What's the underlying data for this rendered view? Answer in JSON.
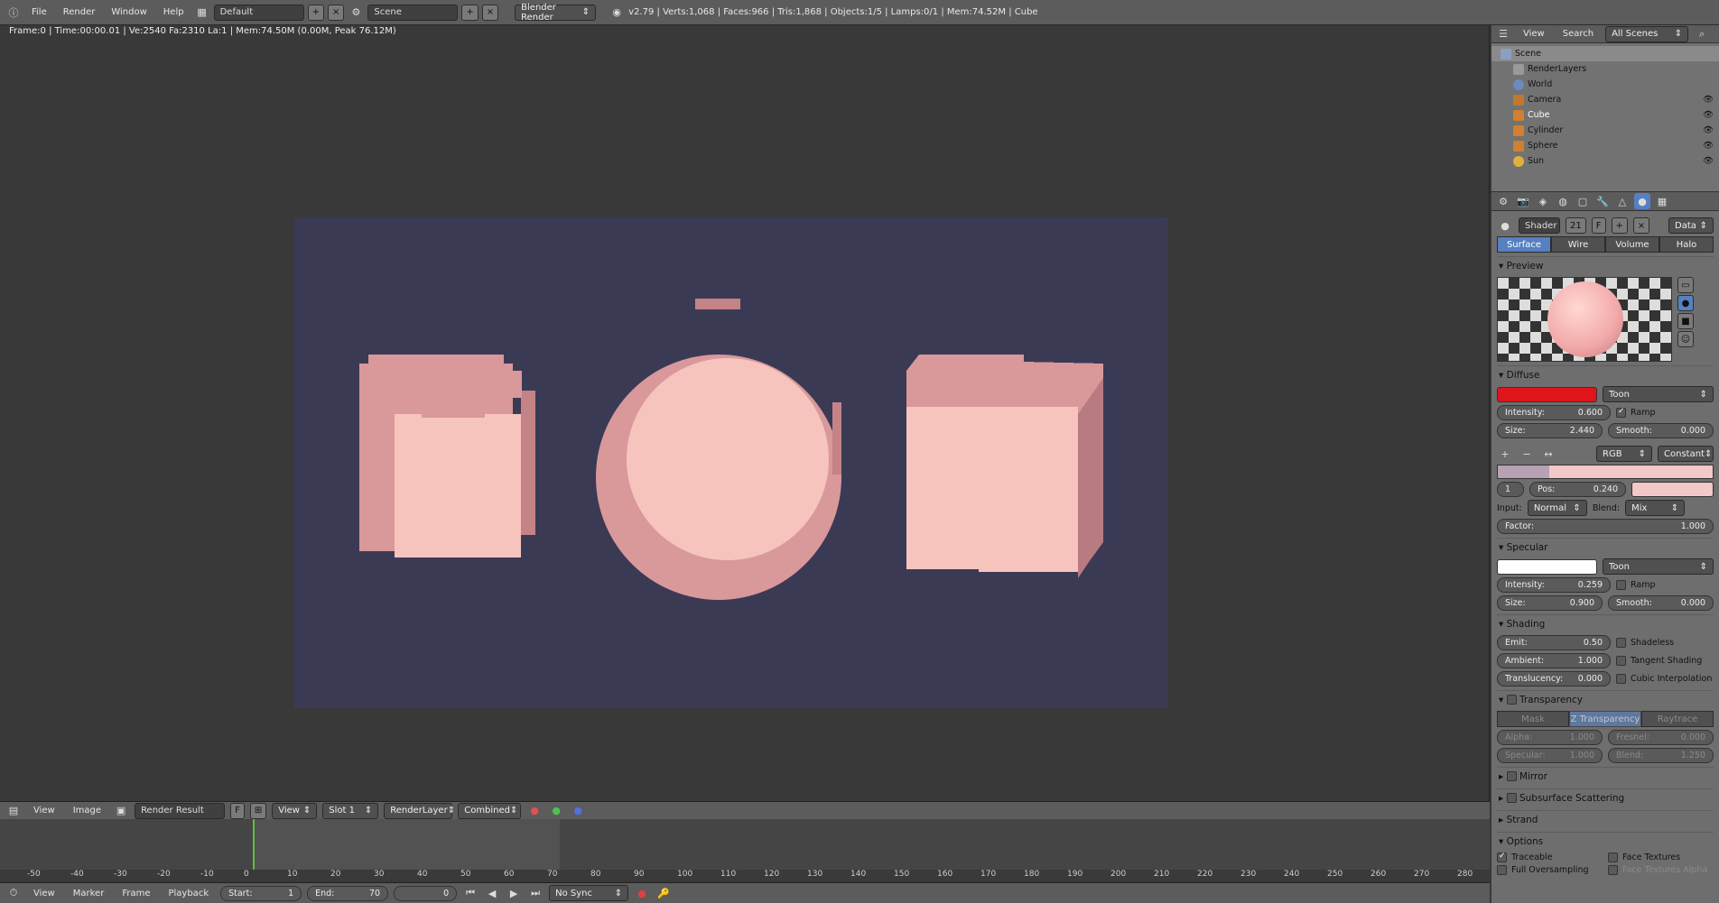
{
  "topbar": {
    "menus": [
      "File",
      "Render",
      "Window",
      "Help"
    ],
    "layout": "Default",
    "scene": "Scene",
    "engine": "Blender Render",
    "stats": "v2.79 | Verts:1,068 | Faces:966 | Tris:1,868 | Objects:1/5 | Lamps:0/1 | Mem:74.52M | Cube"
  },
  "viewport": {
    "info": "Frame:0 | Time:00:00.01 | Ve:2540 Fa:2310 La:1 | Mem:74.50M (0.00M, Peak 76.12M)"
  },
  "render": {
    "bg_color": "#3b3a55",
    "light": "#f6c4bd",
    "mid": "#d9989a",
    "dark": "#b87b82"
  },
  "image_editor": {
    "view": "View",
    "image": "Image",
    "image_name": "Render Result",
    "f_label": "F",
    "view_btn": "View",
    "slot": "Slot 1",
    "layer": "RenderLayer",
    "pass": "Combined"
  },
  "timeline": {
    "ticks": [
      "-50",
      "-40",
      "-30",
      "-20",
      "-10",
      "0",
      "10",
      "20",
      "30",
      "40",
      "50",
      "60",
      "70",
      "80",
      "90",
      "100",
      "110",
      "120",
      "130",
      "140",
      "150",
      "160",
      "170",
      "180",
      "190",
      "200",
      "210",
      "220",
      "230",
      "240",
      "250",
      "260",
      "270",
      "280"
    ],
    "current": 0,
    "menus": [
      "View",
      "Marker",
      "Frame",
      "Playback"
    ],
    "start_label": "Start:",
    "start": "1",
    "end_label": "End:",
    "end": "70",
    "frame": "0",
    "sync": "No Sync"
  },
  "outliner": {
    "view": "View",
    "search": "Search",
    "filter": "All Scenes",
    "items": [
      {
        "name": "Scene",
        "selected": true
      },
      {
        "name": "RenderLayers"
      },
      {
        "name": "World"
      },
      {
        "name": "Camera"
      },
      {
        "name": "Cube"
      },
      {
        "name": "Cylinder"
      },
      {
        "name": "Sphere"
      },
      {
        "name": "Sun"
      }
    ]
  },
  "material": {
    "shader": "Shader",
    "users": "21",
    "f": "F",
    "data": "Data",
    "tabs": [
      "Surface",
      "Wire",
      "Volume",
      "Halo"
    ],
    "preview_title": "Preview",
    "diffuse": {
      "title": "Diffuse",
      "color": "#e0141b",
      "model": "Toon",
      "intensity_label": "Intensity:",
      "intensity": "0.600",
      "ramp": "Ramp",
      "size_label": "Size:",
      "size": "2.440",
      "smooth_label": "Smooth:",
      "smooth": "0.000",
      "ramp_mode": "RGB",
      "interp": "Constant",
      "index": "1",
      "pos_label": "Pos:",
      "pos": "0.240",
      "input_label": "Input:",
      "input": "Normal",
      "blend_label": "Blend:",
      "blend": "Mix",
      "factor_label": "Factor:",
      "factor": "1.000"
    },
    "specular": {
      "title": "Specular",
      "color": "#ffffff",
      "model": "Toon",
      "intensity_label": "Intensity:",
      "intensity": "0.259",
      "ramp": "Ramp",
      "size_label": "Size:",
      "size": "0.900",
      "smooth_label": "Smooth:",
      "smooth": "0.000"
    },
    "shading": {
      "title": "Shading",
      "emit_label": "Emit:",
      "emit": "0.50",
      "shadeless": "Shadeless",
      "ambient_label": "Ambient:",
      "ambient": "1.000",
      "tangent": "Tangent Shading",
      "trans_label": "Translucency:",
      "trans": "0.000",
      "cubic": "Cubic Interpolation"
    },
    "transparency": {
      "title": "Transparency",
      "modes": [
        "Mask",
        "Z Transparency",
        "Raytrace"
      ],
      "alpha_label": "Alpha:",
      "alpha": "1.000",
      "fresnel_label": "Fresnel:",
      "fresnel": "0.000",
      "spec_label": "Specular:",
      "spec": "1.000",
      "blend_label": "Blend:",
      "blend": "1.250"
    },
    "mirror": "Mirror",
    "sss": "Subsurface Scattering",
    "strand": "Strand",
    "options": {
      "title": "Options",
      "traceable": "Traceable",
      "face_textures": "Face Textures",
      "full_over": "Full Oversampling",
      "face_tex_alpha": "Face Textures Alpha"
    }
  }
}
